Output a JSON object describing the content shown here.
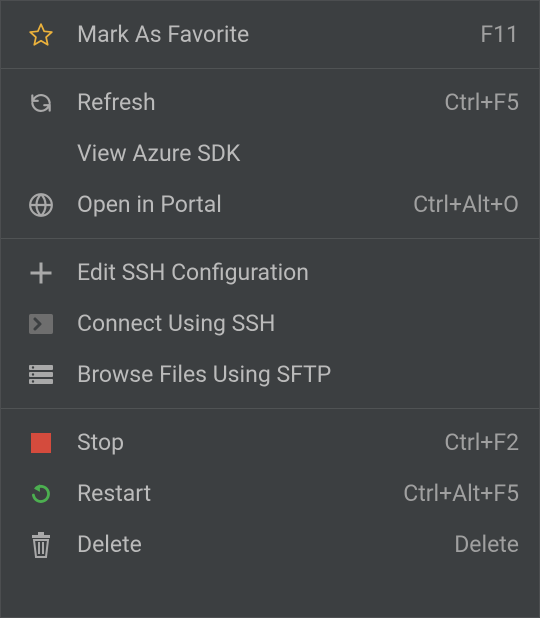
{
  "menu": {
    "items": [
      {
        "id": "favorite",
        "label": "Mark As Favorite",
        "shortcut": "F11",
        "icon": "star-outline-icon"
      },
      {
        "separator": true
      },
      {
        "id": "refresh",
        "label": "Refresh",
        "shortcut": "Ctrl+F5",
        "icon": "refresh-icon"
      },
      {
        "id": "view-azure-sdk",
        "label": "View Azure SDK",
        "shortcut": "",
        "icon": ""
      },
      {
        "id": "open-in-portal",
        "label": "Open in Portal",
        "shortcut": "Ctrl+Alt+O",
        "icon": "globe-icon"
      },
      {
        "separator": true
      },
      {
        "id": "edit-ssh-config",
        "label": "Edit SSH Configuration",
        "shortcut": "",
        "icon": "plus-icon"
      },
      {
        "id": "connect-ssh",
        "label": "Connect Using SSH",
        "shortcut": "",
        "icon": "terminal-icon"
      },
      {
        "id": "browse-sftp",
        "label": "Browse Files Using SFTP",
        "shortcut": "",
        "icon": "server-icon"
      },
      {
        "separator": true
      },
      {
        "id": "stop",
        "label": "Stop",
        "shortcut": "Ctrl+F2",
        "icon": "stop-icon"
      },
      {
        "id": "restart",
        "label": "Restart",
        "shortcut": "Ctrl+Alt+F5",
        "icon": "restart-icon"
      },
      {
        "id": "delete",
        "label": "Delete",
        "shortcut": "Delete",
        "icon": "trash-icon"
      }
    ]
  }
}
